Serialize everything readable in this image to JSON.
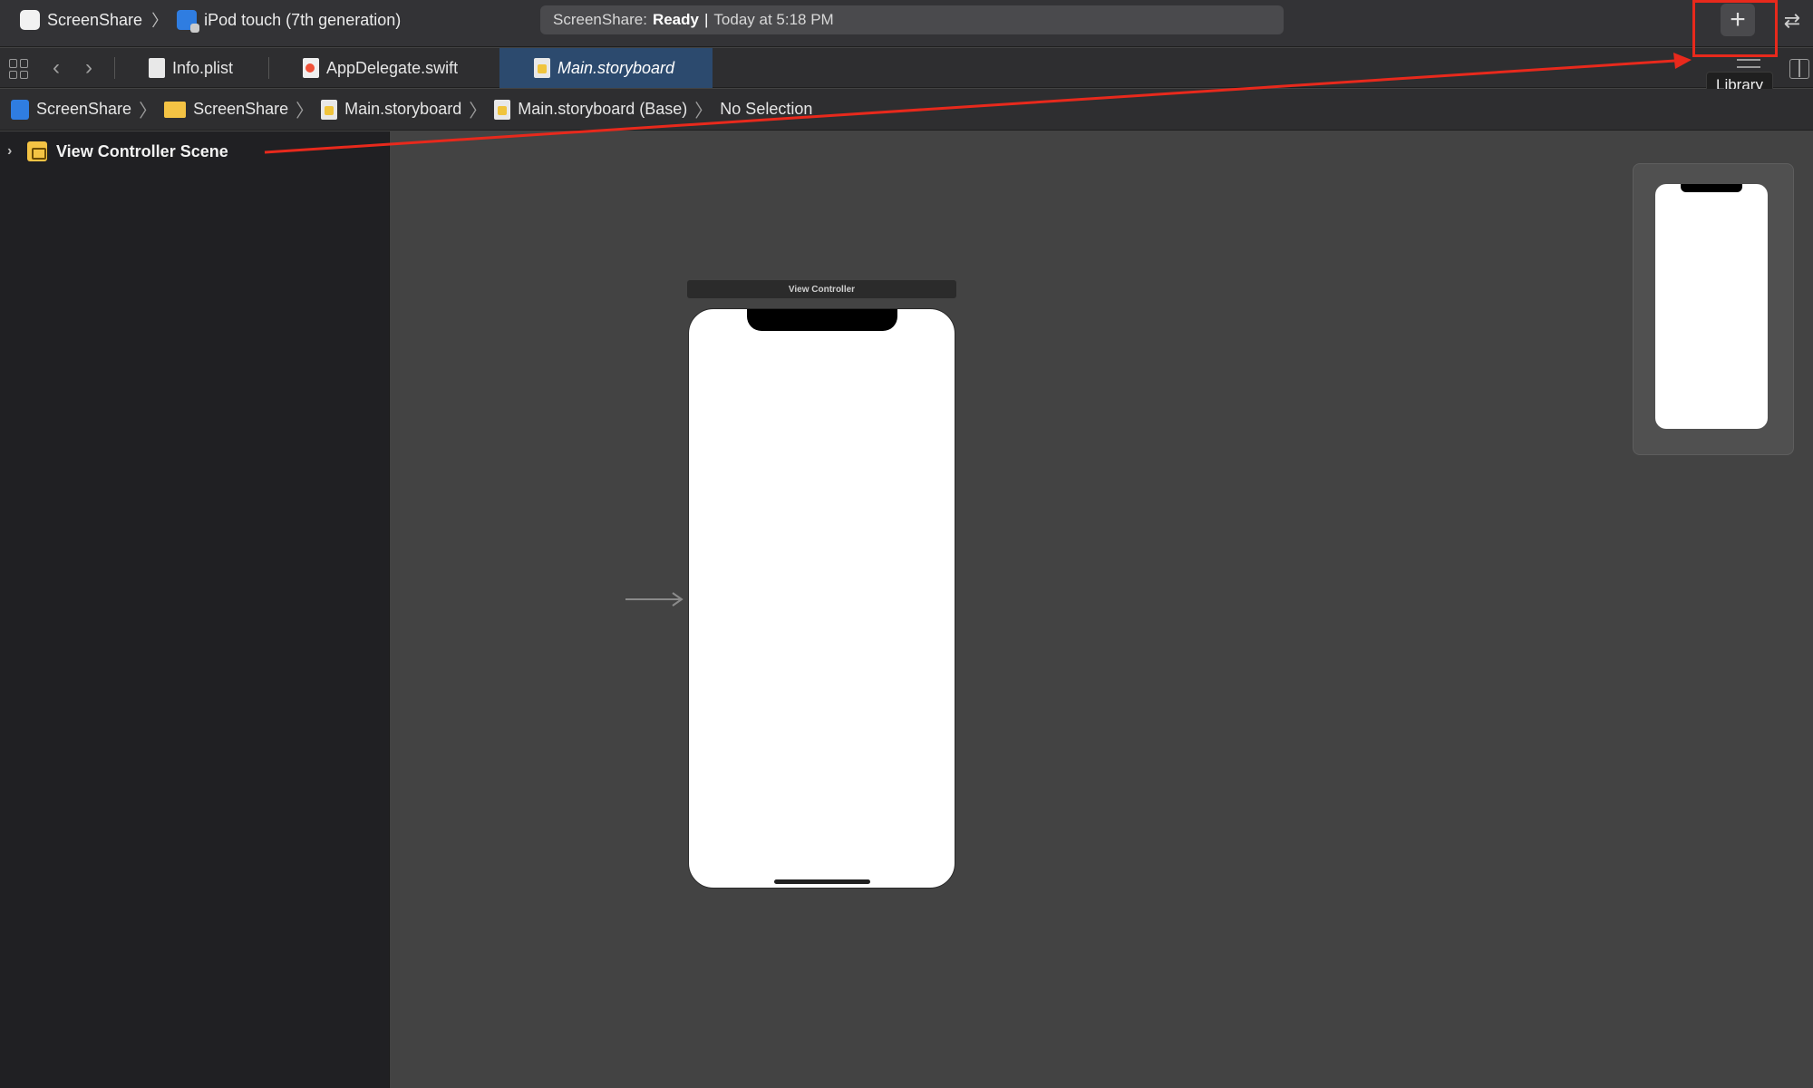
{
  "toolbar": {
    "scheme_name": "ScreenShare",
    "device_name": "iPod touch (7th generation)",
    "status_app": "ScreenShare:",
    "status_state": "Ready",
    "status_time": "Today at 5:18 PM",
    "library_button": "+",
    "library_tooltip": "Library"
  },
  "tabs": [
    {
      "label": "Info.plist",
      "active": false
    },
    {
      "label": "AppDelegate.swift",
      "active": false
    },
    {
      "label": "Main.storyboard",
      "active": true
    }
  ],
  "breadcrumb": [
    "ScreenShare",
    "ScreenShare",
    "Main.storyboard",
    "Main.storyboard (Base)",
    "No Selection"
  ],
  "outline": {
    "scene_label": "View Controller Scene"
  },
  "canvas": {
    "view_controller_title": "View Controller"
  },
  "annotation": {
    "color": "#e8291c"
  }
}
